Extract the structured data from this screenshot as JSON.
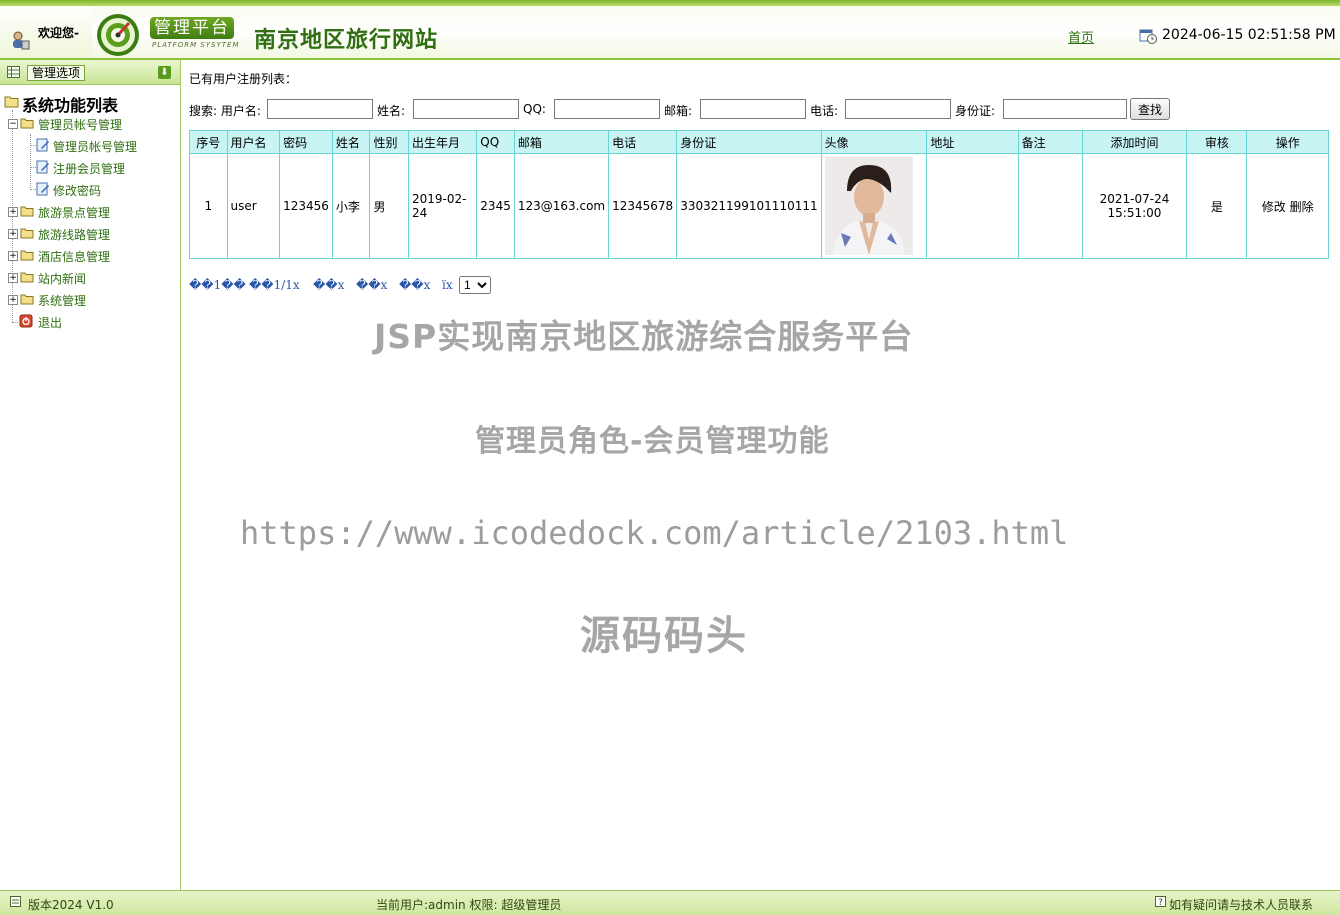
{
  "header": {
    "welcome": "欢迎您-",
    "logo_badge": "管理平台",
    "logo_sub": "PLATFORM SYSYTEM",
    "site_title": "南京地区旅行网站",
    "home_link": "首页",
    "datetime": "2024-06-15 02:51:58 PM"
  },
  "sidebar": {
    "header_title": "管理选项",
    "tree_root": "系统功能列表",
    "items": [
      {
        "label": "管理员帐号管理"
      },
      {
        "label": "管理员帐号管理"
      },
      {
        "label": "注册会员管理"
      },
      {
        "label": "修改密码"
      },
      {
        "label": "旅游景点管理"
      },
      {
        "label": "旅游线路管理"
      },
      {
        "label": "酒店信息管理"
      },
      {
        "label": "站内新闻"
      },
      {
        "label": "系统管理"
      },
      {
        "label": "退出"
      }
    ]
  },
  "main": {
    "list_title": "已有用户注册列表：",
    "search": {
      "prefix": "搜索: 用户名:",
      "name_label": "姓名:",
      "qq_label": "QQ:",
      "email_label": "邮箱:",
      "phone_label": "电话:",
      "id_label": "身份证:",
      "button": "查找"
    },
    "table": {
      "headers": [
        "序号",
        "用户名",
        "密码",
        "姓名",
        "性别",
        "出生年月",
        "QQ",
        "邮箱",
        "电话",
        "身份证",
        "头像",
        "地址",
        "备注",
        "添加时间",
        "审核",
        "操作"
      ],
      "rows": [
        {
          "index": "1",
          "username": "user",
          "password": "123456",
          "name": "小李",
          "gender": "男",
          "birth": "2019-02-24",
          "qq": "2345",
          "email": "123@163.com",
          "phone": "12345678",
          "id_card": "330321199101110111",
          "address": "",
          "note": "",
          "added": "2021-07-24 15:51:00",
          "approved": "是",
          "edit": "修改",
          "delete": "删除"
        }
      ]
    },
    "pager": {
      "first": "��1��",
      "page_info": "��1/1x",
      "prev": "��x",
      "next": "��x",
      "last": "��x",
      "jump": "ïx",
      "selected": "1"
    }
  },
  "watermark": {
    "line1": "JSP实现南京地区旅游综合服务平台",
    "line2": "管理员角色-会员管理功能",
    "line3": "https://www.icodedock.com/article/2103.html",
    "line4": "源码码头"
  },
  "footer": {
    "version": "版本2024 V1.0",
    "current_user": "当前用户:admin 权限:  超级管理员",
    "help": "如有疑问请与技术人员联系"
  },
  "colors": {
    "brand_green": "#2f6f12",
    "table_border": "#6ad3d3",
    "table_header_bg": "#c8f4f4",
    "watermark": "#a6a6a6"
  }
}
